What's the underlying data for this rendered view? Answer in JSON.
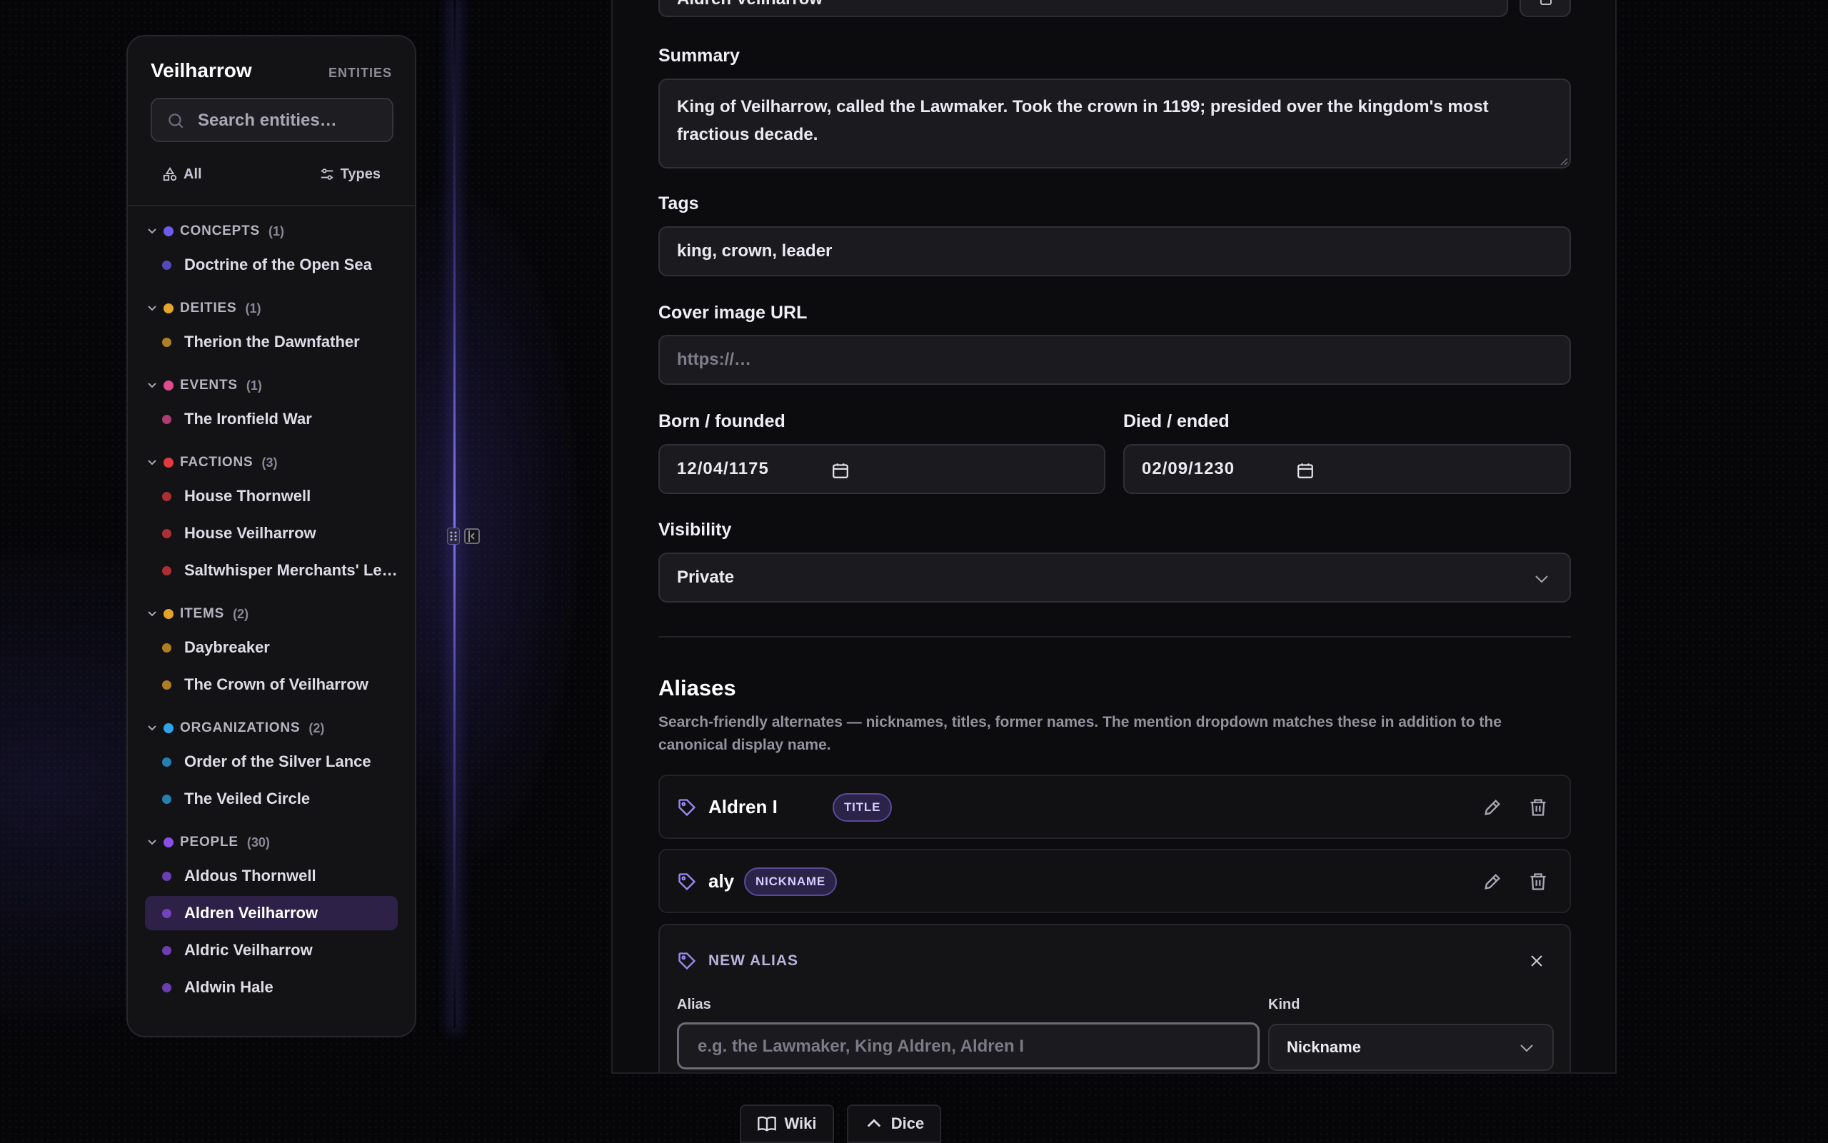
{
  "sidebar": {
    "title": "Veilharrow",
    "entities_label": "ENTITIES",
    "search_placeholder": "Search entities…",
    "filter_all": "All",
    "filter_types": "Types",
    "groups": [
      {
        "label": "CONCEPTS",
        "count": "(1)",
        "color": "#6a5cf0",
        "items": [
          {
            "label": "Doctrine of the Open Sea"
          }
        ]
      },
      {
        "label": "DEITIES",
        "count": "(1)",
        "color": "#e3a52b",
        "items": [
          {
            "label": "Therion the Dawnfather"
          }
        ]
      },
      {
        "label": "EVENTS",
        "count": "(1)",
        "color": "#e24b8f",
        "items": [
          {
            "label": "The Ironfield War"
          }
        ]
      },
      {
        "label": "FACTIONS",
        "count": "(3)",
        "color": "#e03a42",
        "items": [
          {
            "label": "House Thornwell"
          },
          {
            "label": "House Veilharrow"
          },
          {
            "label": "Saltwhisper Merchants' Lea..."
          }
        ]
      },
      {
        "label": "ITEMS",
        "count": "(2)",
        "color": "#e6a12a",
        "items": [
          {
            "label": "Daybreaker"
          },
          {
            "label": "The Crown of Veilharrow"
          }
        ]
      },
      {
        "label": "ORGANIZATIONS",
        "count": "(2)",
        "color": "#2ea3e8",
        "items": [
          {
            "label": "Order of the Silver Lance"
          },
          {
            "label": "The Veiled Circle"
          }
        ]
      },
      {
        "label": "PEOPLE",
        "count": "(30)",
        "color": "#8a4fe6",
        "items": [
          {
            "label": "Aldous Thornwell"
          },
          {
            "label": "Aldren Veilharrow",
            "active": true
          },
          {
            "label": "Aldric Veilharrow"
          },
          {
            "label": "Aldwin Hale"
          }
        ]
      }
    ]
  },
  "form": {
    "display_name_value": "Aldren Veilharrow",
    "summary_label": "Summary",
    "summary_value": "King of Veilharrow, called the Lawmaker. Took the crown in 1199; presided over the kingdom's most fractious decade.",
    "tags_label": "Tags",
    "tags_value": "king, crown, leader",
    "cover_label": "Cover image URL",
    "cover_placeholder": "https://…",
    "born_label": "Born / founded",
    "born_value": "12/04/1175",
    "died_label": "Died / ended",
    "died_value": "02/09/1230",
    "visibility_label": "Visibility",
    "visibility_value": "Private"
  },
  "aliases": {
    "heading": "Aliases",
    "description": "Search-friendly alternates — nicknames, titles, former names. The mention dropdown matches these in addition to the canonical display name.",
    "rows": [
      {
        "name": "Aldren I",
        "kind": "TITLE"
      },
      {
        "name": "aly",
        "kind": "NICKNAME"
      }
    ],
    "new_alias": {
      "heading": "NEW ALIAS",
      "alias_label": "Alias",
      "alias_placeholder": "e.g. the Lawmaker, King Aldren, Aldren I",
      "kind_label": "Kind",
      "kind_value": "Nickname"
    }
  },
  "bottom": {
    "wiki": "Wiki",
    "dice": "Dice"
  },
  "colors": {
    "accent": "#8b7cf0",
    "active_item_bg": "#2d2147"
  }
}
